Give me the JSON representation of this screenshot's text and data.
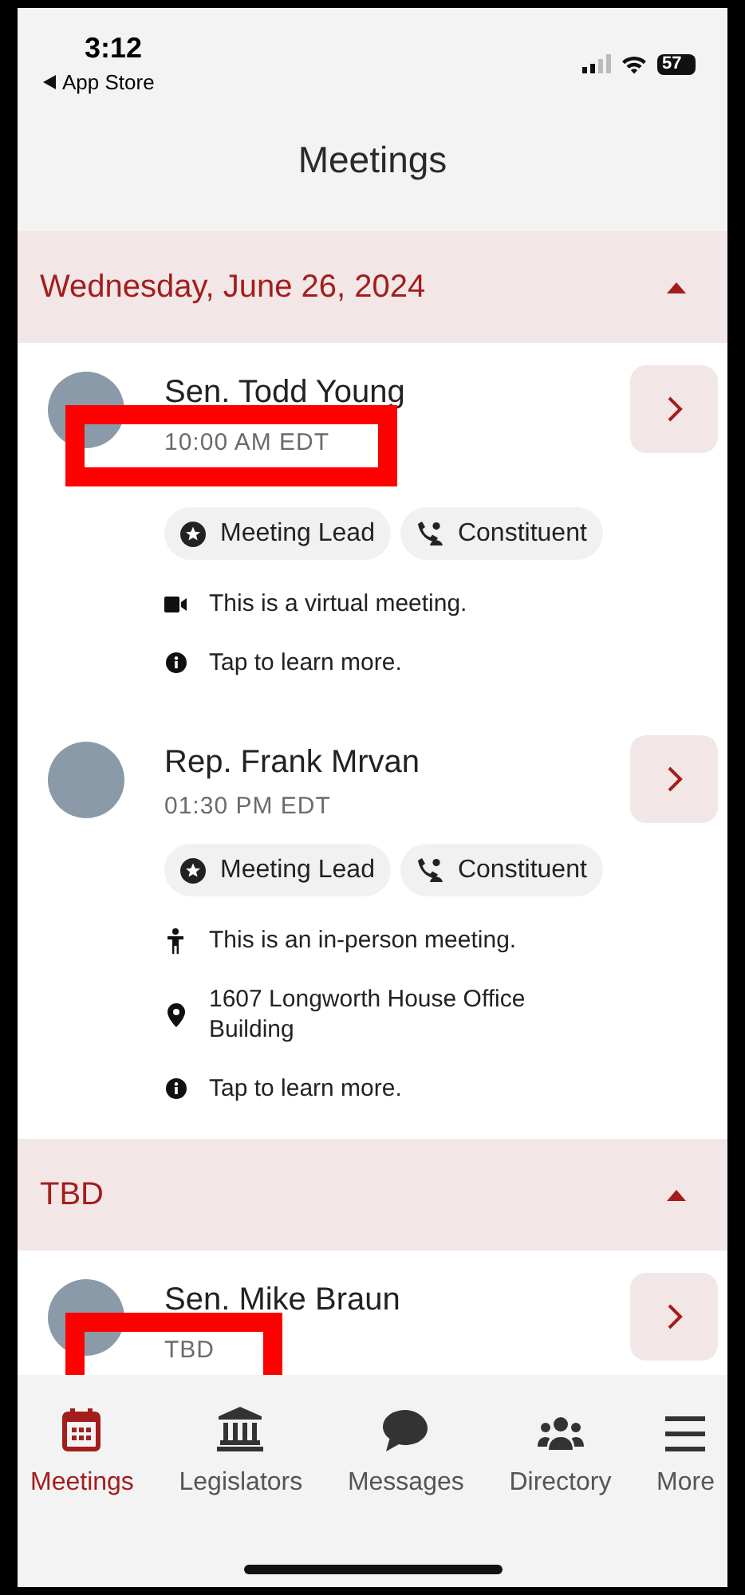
{
  "status_bar": {
    "time": "3:12",
    "back_label": "App Store",
    "battery": "57"
  },
  "title": "Meetings",
  "sections": [
    {
      "title": "Wednesday, June 26, 2024",
      "expanded": true,
      "meetings": [
        {
          "name": "Sen. Todd Young",
          "time": "10:00 AM EDT",
          "highlighted": true,
          "chips": [
            {
              "kind": "lead",
              "label": "Meeting Lead"
            },
            {
              "kind": "constituent",
              "label": "Constituent"
            }
          ],
          "details": [
            {
              "kind": "virtual",
              "text": "This is a virtual meeting."
            },
            {
              "kind": "info",
              "text": "Tap to learn more."
            }
          ]
        },
        {
          "name": "Rep. Frank Mrvan",
          "time": "01:30 PM EDT",
          "highlighted": false,
          "chips": [
            {
              "kind": "lead",
              "label": "Meeting Lead"
            },
            {
              "kind": "constituent",
              "label": "Constituent"
            }
          ],
          "details": [
            {
              "kind": "in_person",
              "text": "This is an in-person meeting."
            },
            {
              "kind": "location",
              "text": "1607 Longworth House Office Building"
            },
            {
              "kind": "info",
              "text": "Tap to learn more."
            }
          ]
        }
      ]
    },
    {
      "title": "TBD",
      "expanded": true,
      "meetings": [
        {
          "name": "Sen. Mike Braun",
          "time": "TBD",
          "highlighted": true
        }
      ]
    }
  ],
  "tabs": [
    {
      "kind": "calendar",
      "label": "Meetings",
      "selected": true
    },
    {
      "kind": "building",
      "label": "Legislators",
      "selected": false
    },
    {
      "kind": "chat",
      "label": "Messages",
      "selected": false
    },
    {
      "kind": "people",
      "label": "Directory",
      "selected": false
    },
    {
      "kind": "menu",
      "label": "More",
      "selected": false
    }
  ]
}
